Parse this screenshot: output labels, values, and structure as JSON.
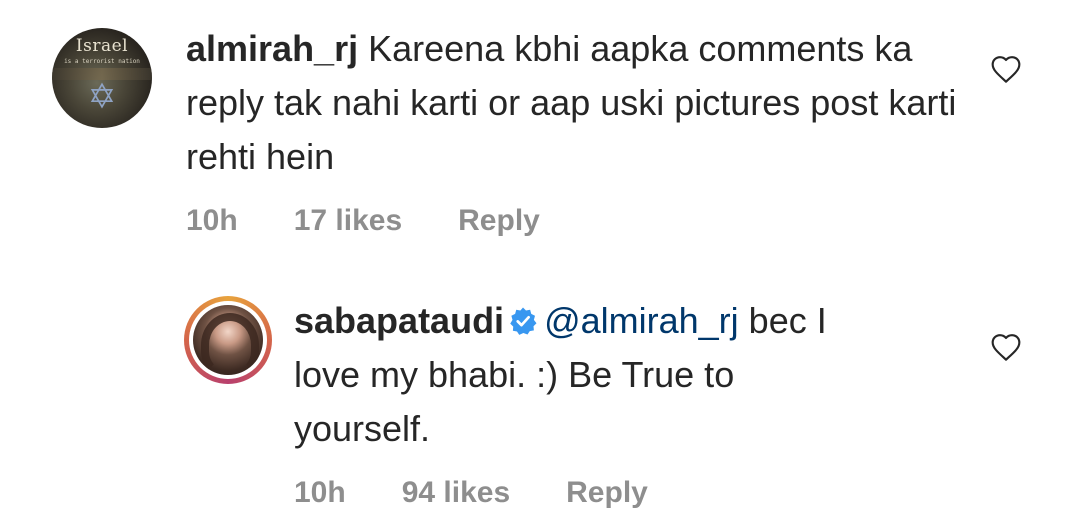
{
  "comments": [
    {
      "avatar": {
        "type": "image",
        "title": "Israel",
        "subtitle": "is a terrorist nation",
        "symbol": "✡"
      },
      "username": "almirah_rj",
      "text": "Kareena kbhi aapka comments ka reply tak nahi karti or aap uski pictures post karti rehti hein",
      "time": "10h",
      "likes": "17 likes",
      "reply": "Reply",
      "icon": "heart-outline-icon"
    },
    {
      "avatar": {
        "type": "image",
        "ring": "story-ring"
      },
      "username": "sabapataudi",
      "verified": true,
      "mention": "@almirah_rj",
      "text": "bec I love my bhabi. :) Be True to yourself.",
      "time": "10h",
      "likes": "94 likes",
      "reply": "Reply",
      "icon": "heart-outline-icon"
    }
  ],
  "colors": {
    "text": "#262626",
    "meta": "#8e8e8e",
    "mention": "#00376b",
    "verified": "#3897f0"
  }
}
